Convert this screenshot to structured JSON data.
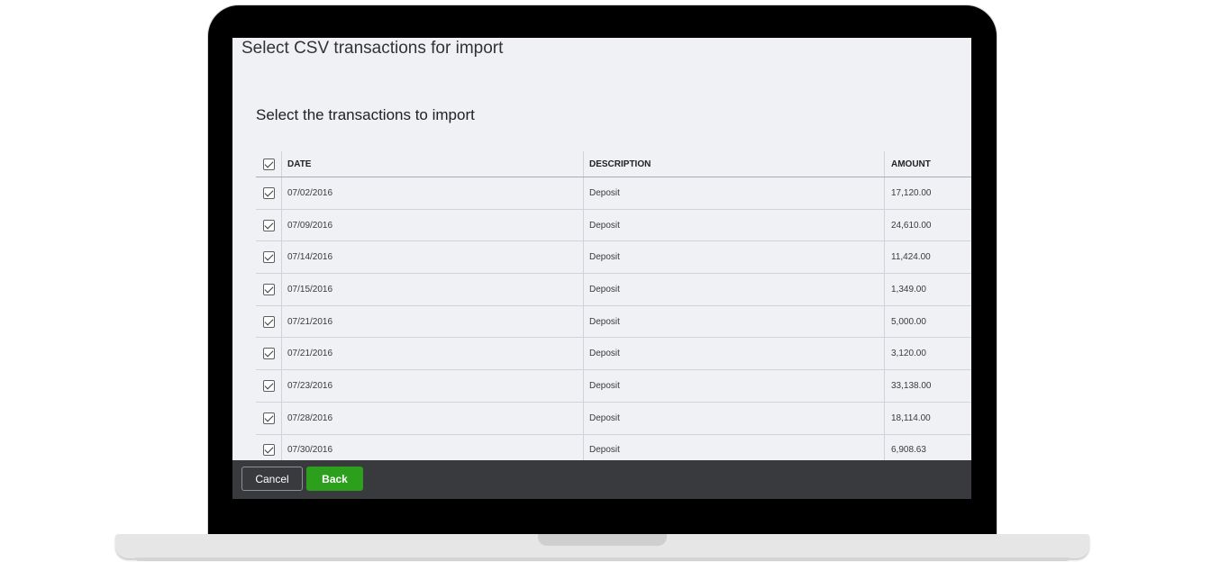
{
  "window": {
    "title": "Select CSV transactions for import"
  },
  "section": {
    "heading": "Select the transactions to import"
  },
  "table": {
    "columns": [
      "DATE",
      "DESCRIPTION",
      "AMOUNT"
    ],
    "rows": [
      {
        "date": "07/02/2016",
        "description": "Deposit",
        "amount": "17,120.00",
        "checked": true
      },
      {
        "date": "07/09/2016",
        "description": "Deposit",
        "amount": "24,610.00",
        "checked": true
      },
      {
        "date": "07/14/2016",
        "description": "Deposit",
        "amount": "11,424.00",
        "checked": true
      },
      {
        "date": "07/15/2016",
        "description": "Deposit",
        "amount": "1,349.00",
        "checked": true
      },
      {
        "date": "07/21/2016",
        "description": "Deposit",
        "amount": "5,000.00",
        "checked": true
      },
      {
        "date": "07/21/2016",
        "description": "Deposit",
        "amount": "3,120.00",
        "checked": true
      },
      {
        "date": "07/23/2016",
        "description": "Deposit",
        "amount": "33,138.00",
        "checked": true
      },
      {
        "date": "07/28/2016",
        "description": "Deposit",
        "amount": "18,114.00",
        "checked": true
      },
      {
        "date": "07/30/2016",
        "description": "Deposit",
        "amount": "6,908.63",
        "checked": true
      }
    ]
  },
  "footer": {
    "cancel_label": "Cancel",
    "back_label": "Back"
  },
  "colors": {
    "accent": "#2ca01c",
    "footer_bg": "#393a3d",
    "screen_bg": "#f0f1f5"
  }
}
